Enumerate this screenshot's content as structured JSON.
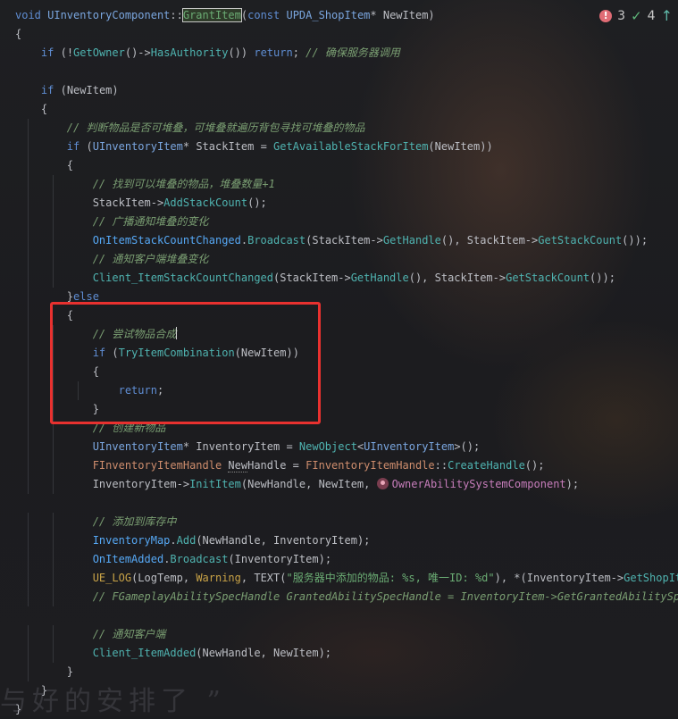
{
  "status": {
    "errors": "3",
    "ok": "4"
  },
  "redbox": "highlight-frame",
  "watermark": "与好的安排了 ”",
  "code": [
    [
      [
        "kw",
        "void "
      ],
      [
        "tp",
        "UInventoryComponent"
      ],
      [
        "",
        "::"
      ],
      [
        "hl",
        "GrantItem"
      ],
      [
        "",
        "("
      ],
      [
        "kw",
        "const "
      ],
      [
        "tp",
        "UPDA_ShopItem"
      ],
      [
        "",
        "* NewItem)"
      ]
    ],
    [
      [
        "",
        "{"
      ]
    ],
    [
      [
        "",
        "    "
      ],
      [
        "kw",
        "if "
      ],
      [
        "",
        "(!"
      ],
      [
        "fn",
        "GetOwner"
      ],
      [
        "",
        "()->"
      ],
      [
        "fn",
        "HasAuthority"
      ],
      [
        "",
        "()) "
      ],
      [
        "kw",
        "return"
      ],
      [
        "",
        "; "
      ],
      [
        "cm",
        "// 确保服务器调用"
      ]
    ],
    [],
    [
      [
        "",
        "    "
      ],
      [
        "kw",
        "if "
      ],
      [
        "",
        "(NewItem)"
      ]
    ],
    [
      [
        "",
        "    {"
      ]
    ],
    [
      [
        "",
        "        "
      ],
      [
        "cm",
        "// 判断物品是否可堆叠，可堆叠就遍历背包寻找可堆叠的物品"
      ]
    ],
    [
      [
        "",
        "        "
      ],
      [
        "kw",
        "if "
      ],
      [
        "",
        "("
      ],
      [
        "tp",
        "UInventoryItem"
      ],
      [
        "",
        "* StackItem = "
      ],
      [
        "fn",
        "GetAvailableStackForItem"
      ],
      [
        "",
        "(NewItem))"
      ]
    ],
    [
      [
        "",
        "        {"
      ]
    ],
    [
      [
        "",
        "            "
      ],
      [
        "cm",
        "// 找到可以堆叠的物品，堆叠数量+1"
      ]
    ],
    [
      [
        "",
        "            StackItem->"
      ],
      [
        "fn",
        "AddStackCount"
      ],
      [
        "",
        "();"
      ]
    ],
    [
      [
        "",
        "            "
      ],
      [
        "cm",
        "// 广播通知堆叠的变化"
      ]
    ],
    [
      [
        "",
        "            "
      ],
      [
        "fnd",
        "OnItemStackCountChanged"
      ],
      [
        "",
        "."
      ],
      [
        "fn",
        "Broadcast"
      ],
      [
        "",
        "(StackItem->"
      ],
      [
        "fn",
        "GetHandle"
      ],
      [
        "",
        "(), StackItem->"
      ],
      [
        "fn",
        "GetStackCount"
      ],
      [
        "",
        "());"
      ]
    ],
    [
      [
        "",
        "            "
      ],
      [
        "cm",
        "// 通知客户端堆叠变化"
      ]
    ],
    [
      [
        "",
        "            "
      ],
      [
        "fn",
        "Client_ItemStackCountChanged"
      ],
      [
        "",
        "(StackItem->"
      ],
      [
        "fn",
        "GetHandle"
      ],
      [
        "",
        "(), StackItem->"
      ],
      [
        "fn",
        "GetStackCount"
      ],
      [
        "",
        "());"
      ]
    ],
    [
      [
        "",
        "        }"
      ],
      [
        "kw",
        "else"
      ]
    ],
    [
      [
        "",
        "        {"
      ]
    ],
    [
      [
        "",
        "            "
      ],
      [
        "cm",
        "// 尝试物品合成"
      ],
      [
        "caret",
        ""
      ]
    ],
    [
      [
        "",
        "            "
      ],
      [
        "kw",
        "if "
      ],
      [
        "",
        "("
      ],
      [
        "fn",
        "TryItemCombination"
      ],
      [
        "",
        "(NewItem))"
      ]
    ],
    [
      [
        "",
        "            {"
      ]
    ],
    [
      [
        "",
        "                "
      ],
      [
        "kw",
        "return"
      ],
      [
        "",
        ";"
      ]
    ],
    [
      [
        "",
        "            }"
      ]
    ],
    [
      [
        "",
        "            "
      ],
      [
        "cm",
        "// 创建新物品"
      ]
    ],
    [
      [
        "",
        "            "
      ],
      [
        "tp",
        "UInventoryItem"
      ],
      [
        "",
        "* InventoryItem = "
      ],
      [
        "fn",
        "NewObject"
      ],
      [
        "",
        "<"
      ],
      [
        "tp",
        "UInventoryItem"
      ],
      [
        "",
        ">();"
      ]
    ],
    [
      [
        "",
        "            "
      ],
      [
        "fm",
        "FInventoryItemHandle "
      ],
      [
        "ul",
        "New"
      ],
      [
        "",
        "Handle = "
      ],
      [
        "fm",
        "FInventoryItemHandle"
      ],
      [
        "",
        "::"
      ],
      [
        "fn",
        "CreateHandle"
      ],
      [
        "",
        "();"
      ]
    ],
    [
      [
        "",
        "            InventoryItem->"
      ],
      [
        "fn",
        "InitItem"
      ],
      [
        "",
        "(NewHandle, NewItem, "
      ],
      [
        "avatar",
        ""
      ],
      [
        "va",
        "OwnerAbilitySystemComponent"
      ],
      [
        "",
        ");"
      ]
    ],
    [],
    [
      [
        "",
        "            "
      ],
      [
        "cm",
        "// 添加到库存中"
      ]
    ],
    [
      [
        "",
        "            "
      ],
      [
        "fnd",
        "InventoryMap"
      ],
      [
        "",
        "."
      ],
      [
        "fn",
        "Add"
      ],
      [
        "",
        "(NewHandle, InventoryItem);"
      ]
    ],
    [
      [
        "",
        "            "
      ],
      [
        "fnd",
        "OnItemAdded"
      ],
      [
        "",
        "."
      ],
      [
        "fn",
        "Broadcast"
      ],
      [
        "",
        "(InventoryItem);"
      ]
    ],
    [
      [
        "",
        "            "
      ],
      [
        "mc",
        "UE_LOG"
      ],
      [
        "",
        "(LogTemp, "
      ],
      [
        "mc",
        "Warning"
      ],
      [
        "",
        ", TEXT("
      ],
      [
        "st",
        "\"服务器中添加的物品: %s, 唯一ID: %d\""
      ],
      [
        "",
        "), *(InventoryItem->"
      ],
      [
        "fn",
        "GetShopItem"
      ]
    ],
    [
      [
        "",
        "            "
      ],
      [
        "cm",
        "// FGameplayAbilitySpecHandle GrantedAbilitySpecHandle = InventoryItem->GetGrantedAbilitySpecH"
      ]
    ],
    [],
    [
      [
        "",
        "            "
      ],
      [
        "cm",
        "// 通知客户端"
      ]
    ],
    [
      [
        "",
        "            "
      ],
      [
        "fn",
        "Client_ItemAdded"
      ],
      [
        "",
        "(NewHandle, NewItem);"
      ]
    ],
    [
      [
        "",
        "        }"
      ]
    ],
    [
      [
        "",
        "    }"
      ]
    ],
    [
      [
        "",
        "}"
      ]
    ]
  ]
}
